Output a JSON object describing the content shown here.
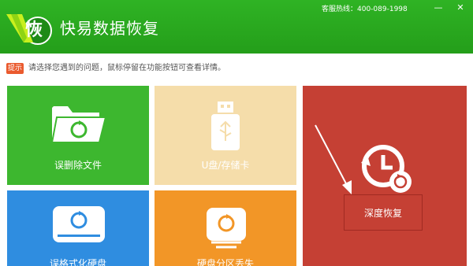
{
  "window": {
    "title": "快易数据恢复",
    "logo_char": "恢",
    "hotline": "客服热线：400-089-1998",
    "minimize_glyph": "—",
    "close_glyph": "✕"
  },
  "hint": {
    "badge": "提示",
    "text": "请选择您遇到的问题，鼠标停留在功能按钮可查看详情。"
  },
  "tiles": [
    {
      "label": "误删除文件",
      "icon": "folder-restore-icon",
      "color": "#3db72f"
    },
    {
      "label": "U盘/存储卡",
      "icon": "usb-drive-icon",
      "color": "#f5ddaa"
    },
    {
      "label": "误格式化硬盘",
      "icon": "hard-disk-restore-icon",
      "color": "#2f8de0"
    },
    {
      "label": "硬盘分区丢失",
      "icon": "drive-partition-icon",
      "color": "#f29627"
    },
    {
      "label": "深度恢复",
      "icon": "clock-restore-icon",
      "color": "#c54034"
    }
  ],
  "colors": {
    "title_bar": "#2fb324",
    "hint_badge": "#ea5a2e"
  }
}
